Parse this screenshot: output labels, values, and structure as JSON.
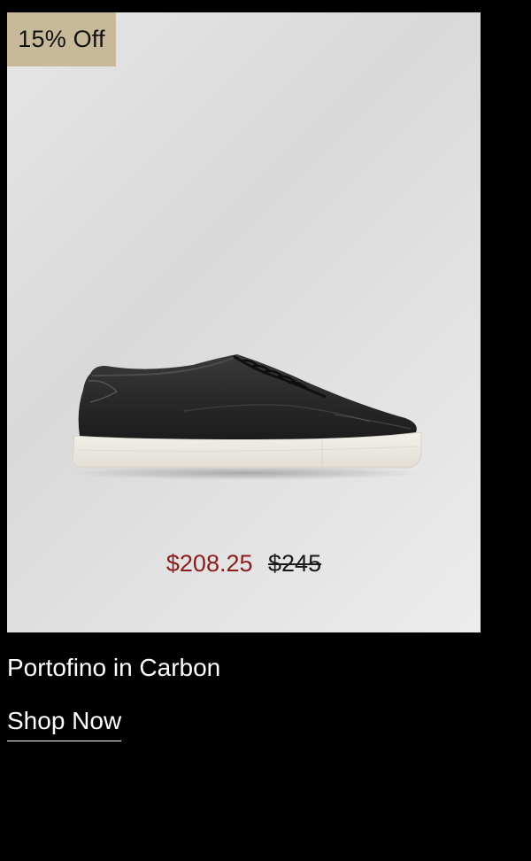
{
  "badge": {
    "label": "15% Off",
    "color": "#c8b99a"
  },
  "product": {
    "name": "Portofino in Carbon",
    "image_icon": "sneaker-image",
    "price": {
      "sale": "$208.25",
      "original": "$245",
      "sale_color": "#8a1c1c"
    }
  },
  "cta": {
    "label": "Shop Now"
  }
}
